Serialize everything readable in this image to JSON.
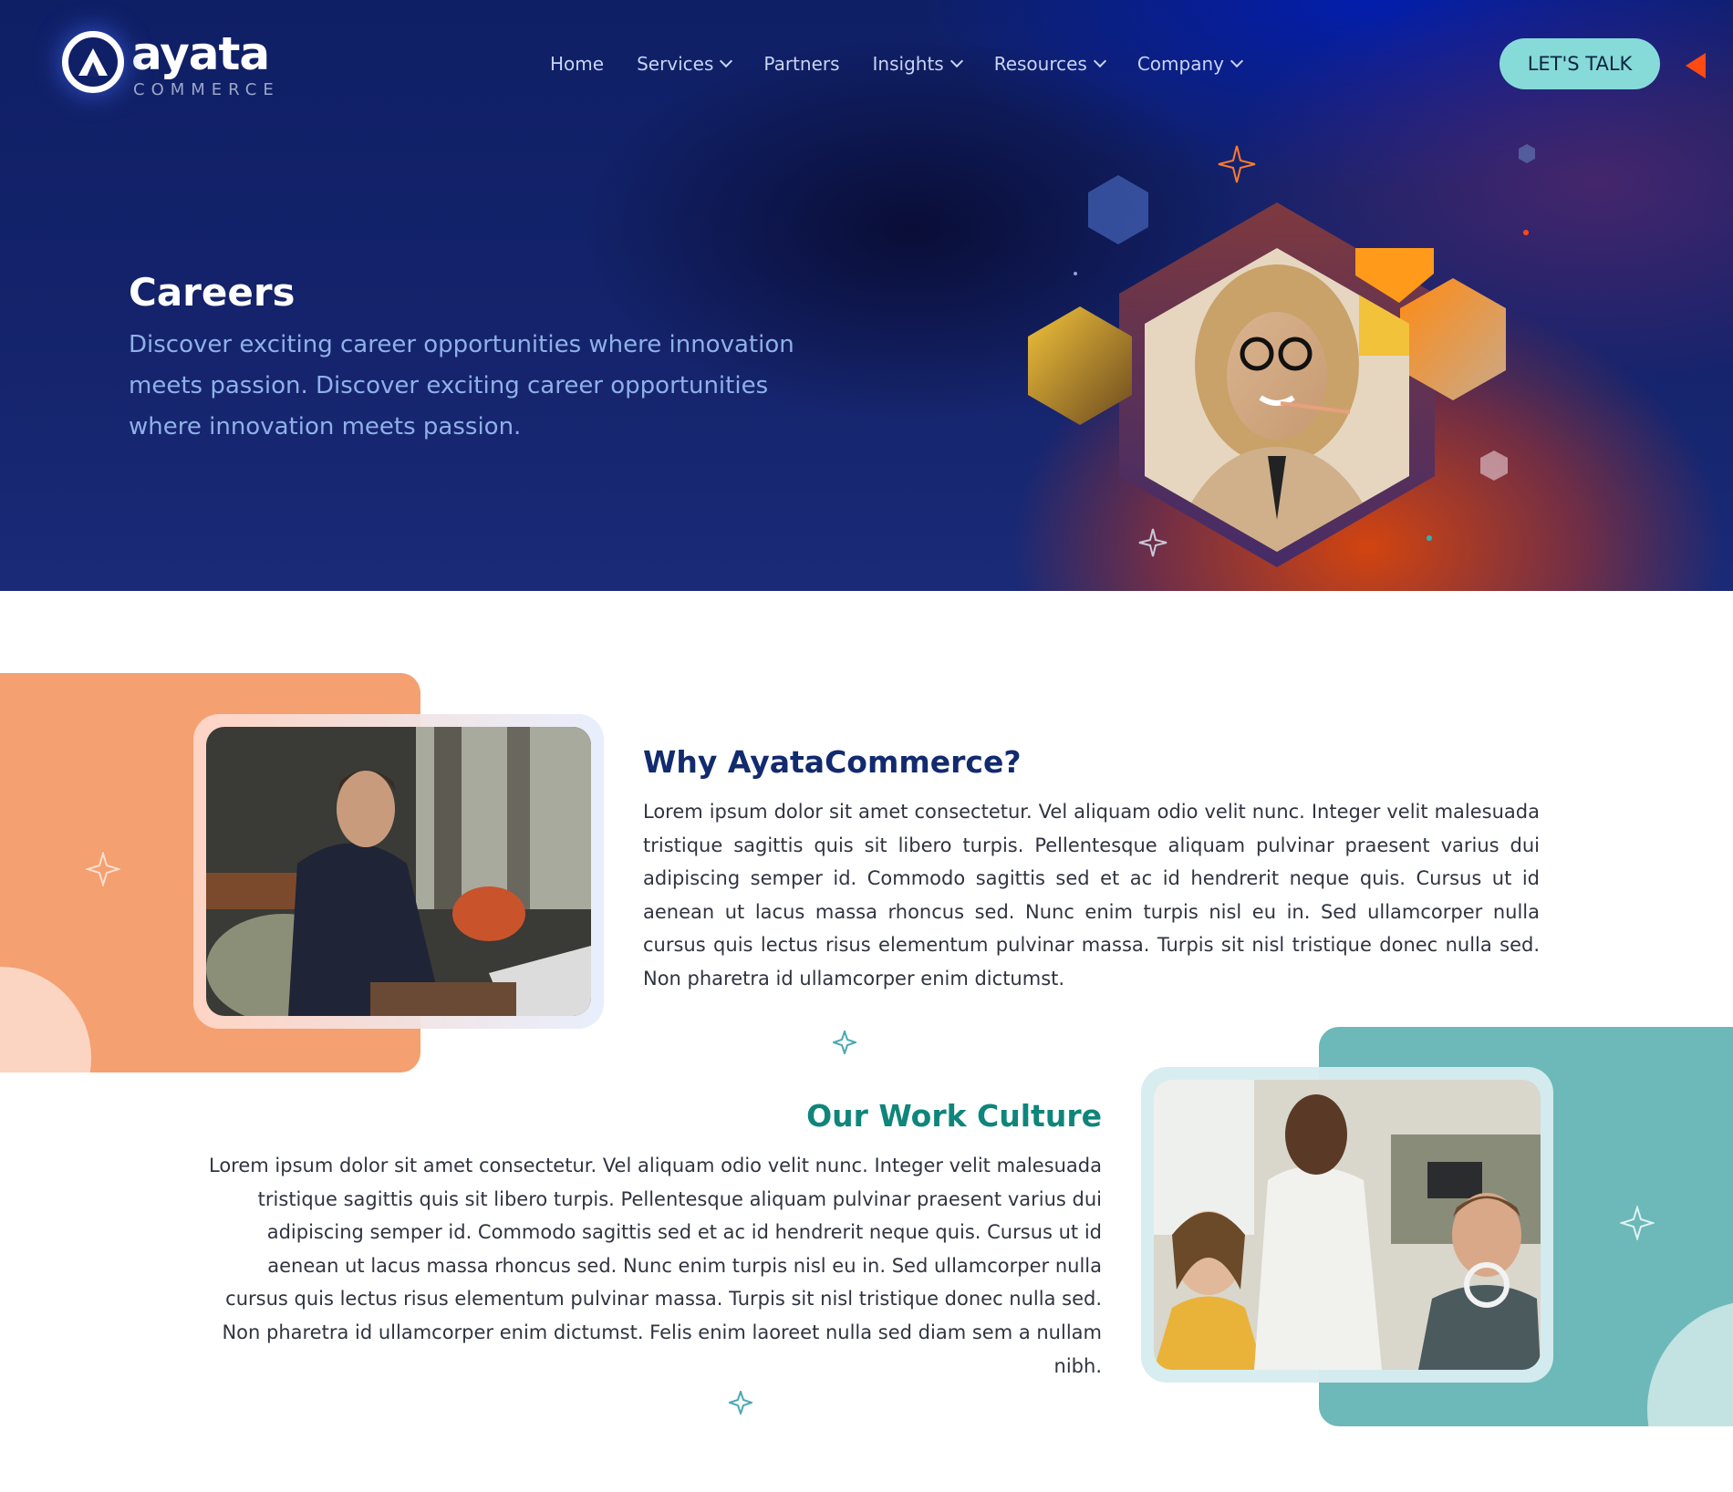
{
  "brand": {
    "name": "ayata",
    "tagline": "COMMERCE"
  },
  "nav": {
    "items": [
      {
        "label": "Home"
      },
      {
        "label": "Services"
      },
      {
        "label": "Partners"
      },
      {
        "label": "Insights"
      },
      {
        "label": "Resources"
      },
      {
        "label": "Company"
      }
    ],
    "cta_label": "LET'S TALK"
  },
  "hero": {
    "title": "Careers",
    "description": "Discover exciting career opportunities where innovation meets passion. Discover exciting career opportunities where innovation meets passion."
  },
  "why": {
    "title": "Why AyataCommerce?",
    "body": "Lorem ipsum dolor sit amet consectetur. Vel aliquam odio velit nunc. Integer velit malesuada tristique sagittis quis sit libero turpis. Pellentesque aliquam pulvinar praesent varius dui adipiscing semper id. Commodo sagittis sed et ac id hendrerit neque quis. Cursus ut id aenean ut lacus massa rhoncus sed. Nunc enim turpis nisl eu in. Sed ullamcorper nulla cursus quis lectus risus elementum pulvinar massa. Turpis sit nisl tristique donec nulla sed. Non pharetra id ullamcorper enim dictumst."
  },
  "culture": {
    "title": "Our Work Culture",
    "body": "Lorem ipsum dolor sit amet consectetur. Vel aliquam odio velit nunc. Integer velit malesuada tristique sagittis quis sit libero turpis. Pellentesque aliquam pulvinar praesent varius dui adipiscing semper id. Commodo sagittis sed et ac id hendrerit neque quis. Cursus ut id aenean ut lacus massa rhoncus sed. Nunc enim turpis nisl eu in. Sed ullamcorper nulla cursus quis lectus risus elementum pulvinar massa. Turpis sit nisl tristique donec nulla sed. Non pharetra id ullamcorper enim dictumst. Felis enim laoreet nulla sed diam sem a nullam nibh."
  },
  "colors": {
    "hero_navy": "#14236b",
    "cta_teal": "#86dbd9",
    "accent_orange": "#f4a071",
    "accent_teal": "#6db9b9",
    "heading_navy": "#122a6e",
    "heading_teal": "#0f857b"
  },
  "icons": [
    "ayata-logo-icon",
    "chevron-down-icon",
    "sparkle-icon",
    "arrow-left-icon"
  ]
}
